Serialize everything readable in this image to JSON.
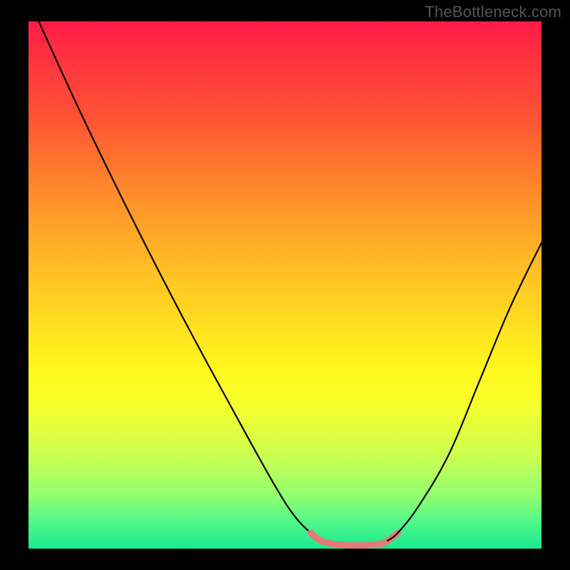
{
  "watermark": "TheBottleneck.com",
  "chart_data": {
    "type": "line",
    "title": "",
    "xlabel": "",
    "ylabel": "",
    "xlim": [
      0,
      100
    ],
    "ylim": [
      0,
      100
    ],
    "grid": false,
    "legend": false,
    "background_gradient": {
      "top": "#ff1a4a",
      "bottom": "#18e890",
      "stops": [
        "red",
        "orange",
        "yellow",
        "green"
      ]
    },
    "series": [
      {
        "name": "left-curve",
        "stroke": "#000000",
        "x": [
          2,
          10,
          20,
          30,
          40,
          48,
          52,
          55,
          57
        ],
        "y": [
          100,
          83,
          63,
          44,
          26,
          12,
          6,
          3,
          1.5
        ]
      },
      {
        "name": "flat-segment",
        "stroke": "#e47a78",
        "x": [
          55,
          57,
          60,
          64,
          68,
          70,
          72
        ],
        "y": [
          3,
          1.5,
          0.8,
          0.6,
          0.8,
          1.5,
          3
        ]
      },
      {
        "name": "right-curve",
        "stroke": "#000000",
        "x": [
          70,
          72,
          76,
          82,
          88,
          94,
          100
        ],
        "y": [
          1.5,
          3,
          8,
          18,
          32,
          46,
          58
        ]
      }
    ],
    "annotations": []
  }
}
